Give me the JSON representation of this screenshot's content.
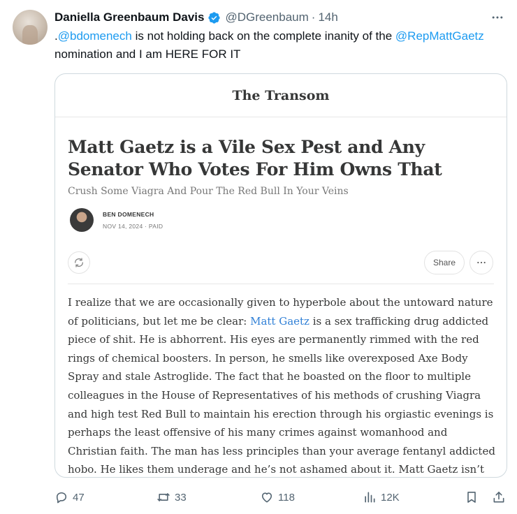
{
  "tweet": {
    "author_name": "Daniella Greenbaum Davis",
    "handle": "@DGreenbaum",
    "separator": "·",
    "time": "14h",
    "text_prefix": ".",
    "mention_1": "@bdomenech",
    "text_mid": " is not holding back on the complete inanity of the ",
    "mention_2": "@RepMattGaetz",
    "text_suffix": " nomination and I am HERE FOR IT"
  },
  "card": {
    "publication": "The Transom",
    "headline": "Matt Gaetz is a Vile Sex Pest and Any Senator Who Votes For Him Owns That",
    "subtitle": "Crush Some Viagra And Pour The Red Bull In Your Veins",
    "author": "BEN DOMENECH",
    "meta": "NOV 14, 2024 · PAID",
    "share_label": "Share",
    "body_start": "I realize that we are occasionally given to hyperbole about the untoward nature of politicians, but let me be clear: ",
    "body_link": "Matt Gaetz",
    "body_rest": " is a sex trafficking drug addicted piece of shit. He is abhorrent. His eyes are permanently rimmed with the red rings of chemical boosters. In person, he smells like overexposed Axe Body Spray and stale Astroglide. The fact that he boasted on the floor to multiple colleagues in the House of Representatives of his methods of crushing Viagra and high test Red Bull to maintain his erection through his orgiastic evenings is perhaps the least offensive of his many crimes against womanhood and Christian faith. The man has less principles than your average fentanyl addicted hobo. He likes them underage and he’s not ashamed about it. Matt Gaetz isn’t just your average"
  },
  "actions": {
    "replies": "47",
    "reposts": "33",
    "likes": "118",
    "views": "12K"
  },
  "icons": [
    "more-icon",
    "verified-icon",
    "refresh-icon",
    "reply-icon",
    "repost-icon",
    "like-icon",
    "views-icon",
    "bookmark-icon",
    "share-icon"
  ],
  "colors": {
    "accent": "#1d9bf0",
    "muted": "#536471",
    "article_link": "#2f7fd6"
  }
}
